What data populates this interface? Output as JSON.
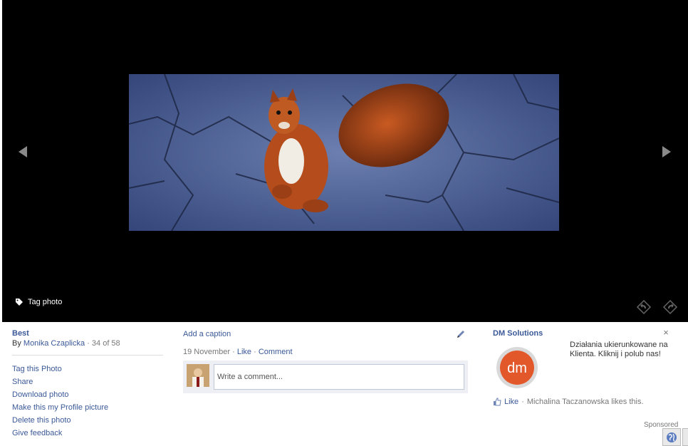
{
  "viewer": {
    "tag_photo_label": "Tag photo",
    "icons": [
      "prev-arrow-icon",
      "next-arrow-icon",
      "tag-icon",
      "rotate-left-icon",
      "rotate-right-icon"
    ]
  },
  "album": {
    "title": "Best",
    "by_prefix": "By",
    "author": "Monika Czaplicka",
    "separator": "·",
    "position": "34 of 58"
  },
  "actions": [
    "Tag this Photo",
    "Share",
    "Download photo",
    "Make this my Profile picture",
    "Delete this photo",
    "Give feedback"
  ],
  "caption": {
    "add_caption_label": "Add a caption"
  },
  "meta": {
    "date": "19 November",
    "like": "Like",
    "comment": "Comment"
  },
  "comment_box": {
    "placeholder": "Write a comment..."
  },
  "ad": {
    "title": "DM Solutions",
    "close": "×",
    "text": "Działania ukierunkowane na Klienta. Kliknij i polub nas!",
    "like_label": "Like",
    "social": "Michalina Taczanowska likes this.",
    "sponsored": "Sponsored",
    "logo_text": "dm",
    "brand_color": "#e2582b"
  },
  "colors": {
    "link": "#3b5998",
    "viewer_bg": "#000000"
  }
}
